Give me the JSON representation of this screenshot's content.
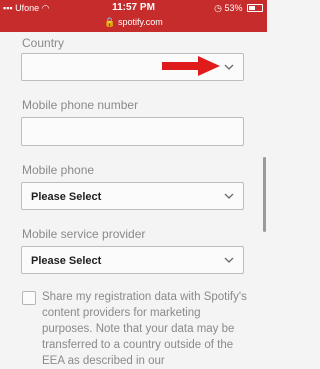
{
  "status_bar": {
    "carrier": "Ufone",
    "time": "11:57 PM",
    "battery": "53%",
    "battery_level": 0.53
  },
  "url_bar": {
    "domain": "spotify.com"
  },
  "form": {
    "country": {
      "label": "Country",
      "value": ""
    },
    "mobile_number": {
      "label": "Mobile phone number",
      "value": ""
    },
    "mobile_phone": {
      "label": "Mobile phone",
      "value": "Please Select"
    },
    "service_provider": {
      "label": "Mobile service provider",
      "value": "Please Select"
    },
    "consent": {
      "text": "Share my registration data with Spotify's content providers for marketing purposes. Note that your data may be transferred to a country outside of the EEA as described in our",
      "checked": false
    }
  },
  "annotation": {
    "color": "#e01b1b"
  }
}
